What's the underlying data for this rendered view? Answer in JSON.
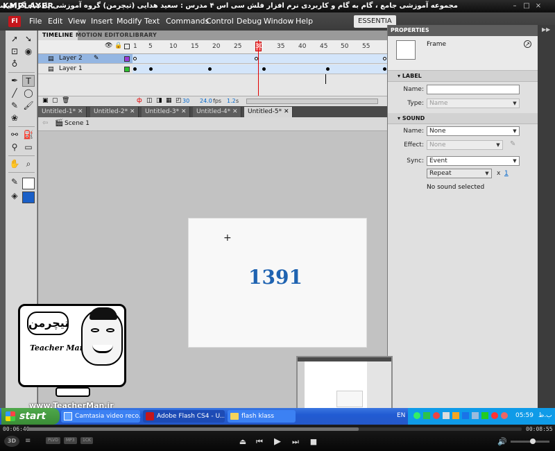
{
  "player": {
    "name": "KMPLAYER",
    "caption": "مجموعه آموزشی جامع ، گام به گام و کاربردی نرم افزار فلش سی اس ۴ مدرس : سعید هدایی (تیچرمن) گروه آموزشی پادشاه گرافیست ها",
    "elapsed": "00:06:40",
    "total": "00:08:55",
    "progress": 0.67,
    "badges": [
      "PLVD",
      "MP3",
      "1CK"
    ]
  },
  "menubar": {
    "logo": "Fl",
    "items": [
      "File",
      "Edit",
      "View",
      "Insert",
      "Modify",
      "Text",
      "Commands",
      "Control",
      "Debug",
      "Window",
      "Help"
    ],
    "workspace": "ESSENTIA"
  },
  "panel_tabs": [
    "TIMELINE",
    "MOTION EDITOR",
    "LIBRARY"
  ],
  "timeline": {
    "frame_numbers": [
      "1",
      "5",
      "10",
      "15",
      "20",
      "25",
      "30",
      "35",
      "40",
      "45",
      "50",
      "55"
    ],
    "layers": [
      {
        "name": "Layer 2",
        "selected": true
      },
      {
        "name": "Layer 1",
        "selected": false
      }
    ],
    "current_frame": "30",
    "fps": "24.0",
    "fps_unit": "fps",
    "time": "1.2",
    "time_unit": "s"
  },
  "doc_tabs": [
    "Untitled-1*",
    "Untitled-2*",
    "Untitled-3*",
    "Untitled-4*",
    "Untitled-5*"
  ],
  "scene": "Scene 1",
  "stage": {
    "text": "1391",
    "color": "#1f63b1"
  },
  "properties": {
    "tab": "PROPERTIES",
    "frame_label": "Frame",
    "label_section": "LABEL",
    "name_label": "Name:",
    "name_value": "",
    "type_label": "Type:",
    "type_value": "Name",
    "sound_section": "SOUND",
    "sound_name_label": "Name:",
    "sound_name_value": "None",
    "effect_label": "Effect:",
    "effect_value": "None",
    "sync_label": "Sync:",
    "sync_value": "Event",
    "repeat_value": "Repeat",
    "repeat_x": "x",
    "repeat_count": "1",
    "no_sound": "No sound selected"
  },
  "overlay": {
    "logo_persian": "تیچرمن",
    "logo_name": "Teacher Man",
    "watermark": "www.TeacherMan.ir"
  },
  "taskbar": {
    "start": "start",
    "tasks": [
      {
        "label": "Camtasia video reco...",
        "active": false
      },
      {
        "label": "Adobe Flash CS4 - U...",
        "active": true
      },
      {
        "label": "flash klass",
        "active": false
      }
    ],
    "lang": "EN",
    "time": "05:59",
    "ampm": "ب.ظ"
  },
  "colors": {
    "accent": "#1f63b1",
    "flash_red": "#c4161c",
    "xp_blue": "#2558c8",
    "start_green": "#3a8c36"
  }
}
